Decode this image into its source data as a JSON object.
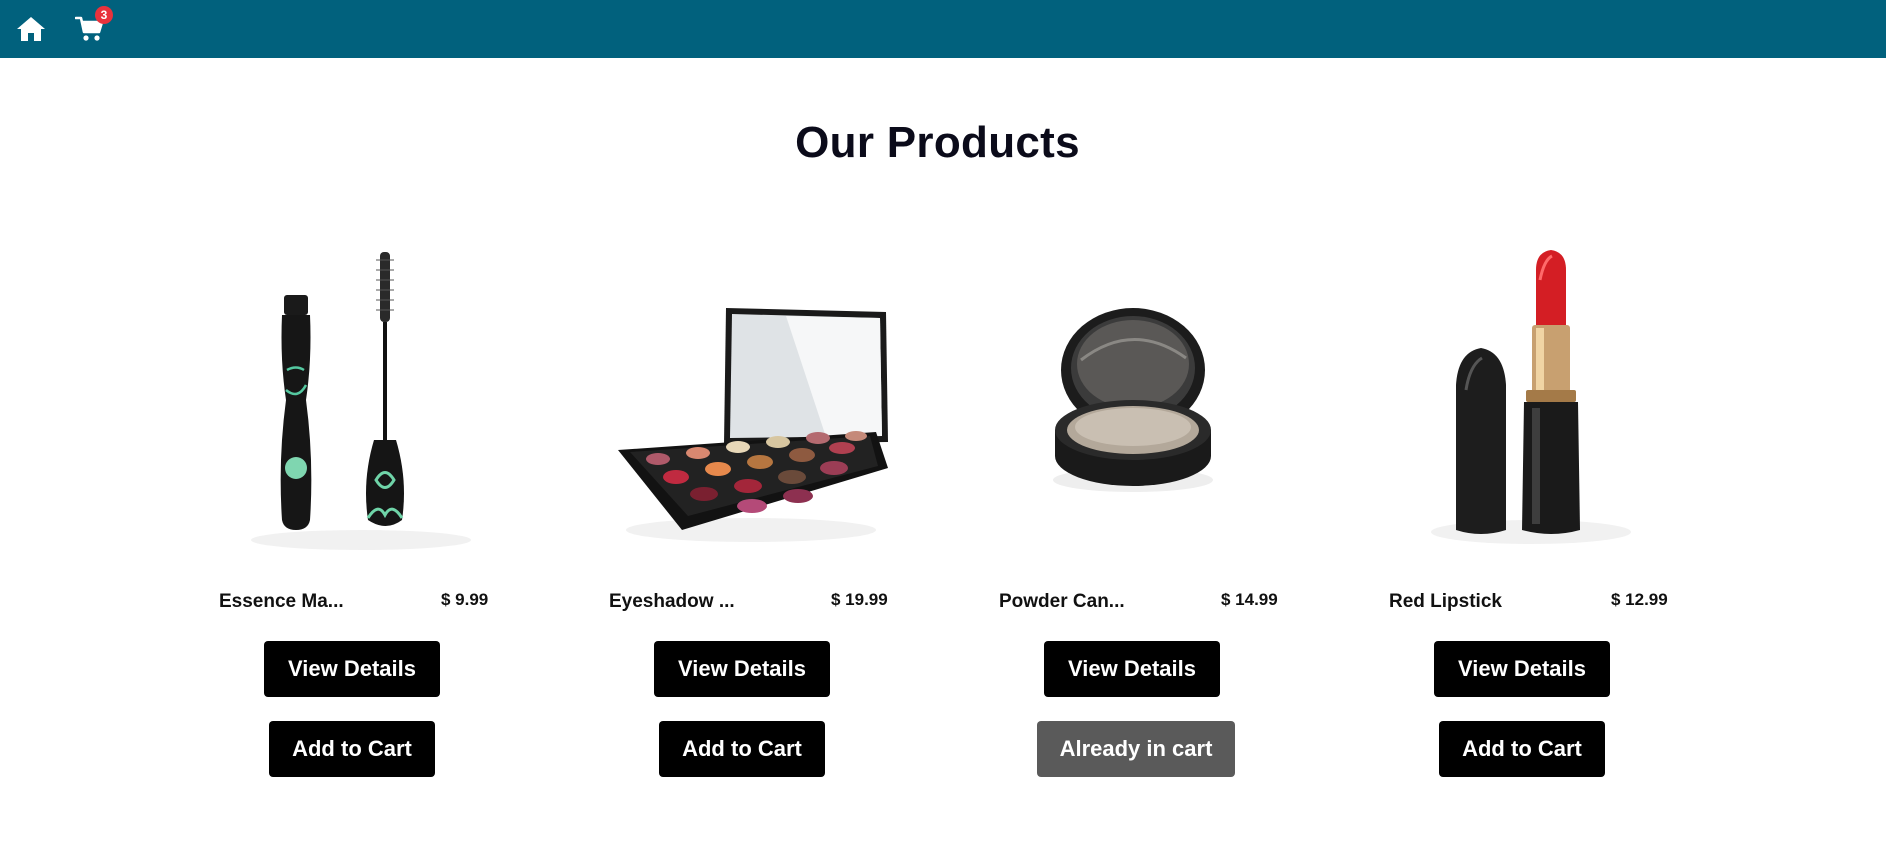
{
  "header": {
    "home_icon": "home-icon",
    "cart_icon": "cart-icon",
    "cart_count": "3",
    "bar_color": "#01617d"
  },
  "main": {
    "title": "Our Products"
  },
  "products": [
    {
      "name": "Essence Ma...",
      "price": "$ 9.99",
      "details_label": "View Details",
      "cart_label": "Add to Cart",
      "in_cart": false,
      "image": "mascara"
    },
    {
      "name": "Eyeshadow ...",
      "price": "$ 19.99",
      "details_label": "View Details",
      "cart_label": "Add to Cart",
      "in_cart": false,
      "image": "eyeshadow-palette"
    },
    {
      "name": "Powder Can...",
      "price": "$ 14.99",
      "details_label": "View Details",
      "cart_label": "Already in cart",
      "in_cart": true,
      "image": "powder-compact"
    },
    {
      "name": "Red Lipstick",
      "price": "$ 12.99",
      "details_label": "View Details",
      "cart_label": "Add to Cart",
      "in_cart": false,
      "image": "lipstick"
    }
  ]
}
